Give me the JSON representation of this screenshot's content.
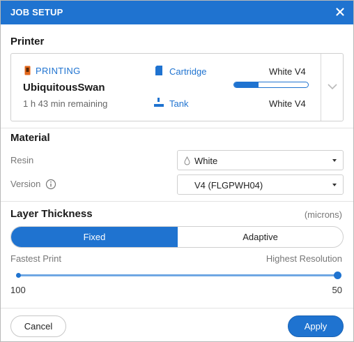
{
  "dialog": {
    "title": "JOB SETUP"
  },
  "printer": {
    "section_title": "Printer",
    "status": "PRINTING",
    "name": "UbiquitousSwan",
    "remaining": "1 h 43 min remaining",
    "cartridge_label": "Cartridge",
    "cartridge_value": "White V4",
    "cartridge_fill_fraction": 0.33,
    "tank_label": "Tank",
    "tank_value": "White V4"
  },
  "material": {
    "section_title": "Material",
    "resin_label": "Resin",
    "resin_value": "White",
    "version_label": "Version",
    "version_value": "V4 (FLGPWH04)"
  },
  "layer": {
    "section_title": "Layer Thickness",
    "units": "(microns)",
    "modes": [
      "Fixed",
      "Adaptive"
    ],
    "active_mode": "Fixed",
    "slider_left_label": "Fastest Print",
    "slider_right_label": "Highest Resolution",
    "slider_min": "100",
    "slider_max": "50",
    "slider_value_fraction": 1.0
  },
  "actions": {
    "cancel": "Cancel",
    "apply": "Apply"
  },
  "colors": {
    "accent": "#1f73d0",
    "header_bg": "#1f73d0",
    "status_icon": "#e2661a"
  },
  "icons": {
    "close": "close-icon",
    "status": "printer-status-icon",
    "cartridge": "cartridge-icon",
    "tank": "tank-icon",
    "info": "info-icon",
    "droplet": "droplet-icon",
    "chevron": "chevron-down-icon"
  }
}
